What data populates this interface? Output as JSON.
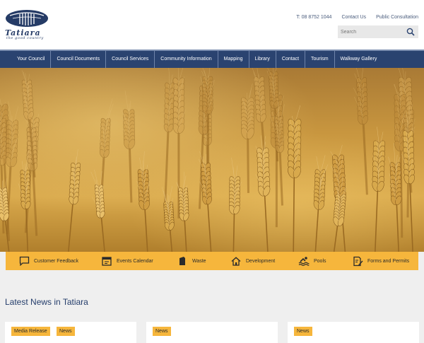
{
  "header": {
    "logo_text": "Tatiara",
    "logo_tagline": "the good country",
    "phone": "T: 08 8752 1044",
    "contact_link": "Contact Us",
    "consultation_link": "Public Consultation",
    "search_placeholder": "Search"
  },
  "nav": {
    "items": [
      {
        "label": "Your Council"
      },
      {
        "label": "Council Documents"
      },
      {
        "label": "Council Services"
      },
      {
        "label": "Community Information"
      },
      {
        "label": "Mapping"
      },
      {
        "label": "Library"
      },
      {
        "label": "Contact"
      },
      {
        "label": "Tourism"
      },
      {
        "label": "Walkway Gallery"
      }
    ]
  },
  "hero": {
    "slide_count": 6,
    "active_slide": 1
  },
  "quick_links": {
    "items": [
      {
        "label": "Customer Feedback",
        "icon": "speech-bubble-icon"
      },
      {
        "label": "Events Calendar",
        "icon": "calendar-icon"
      },
      {
        "label": "Waste",
        "icon": "bin-icon"
      },
      {
        "label": "Development",
        "icon": "house-icon"
      },
      {
        "label": "Pools",
        "icon": "swimmer-icon"
      },
      {
        "label": "Forms and Permits",
        "icon": "form-pen-icon"
      }
    ]
  },
  "news": {
    "heading": "Latest News in Tatiara",
    "cards": [
      {
        "tags": [
          "Media Release",
          "News"
        ]
      },
      {
        "tags": [
          "News"
        ]
      },
      {
        "tags": [
          "News"
        ]
      }
    ]
  },
  "colors": {
    "navy": "#2a4370",
    "accent": "#f6b63c",
    "background": "#efefef"
  }
}
